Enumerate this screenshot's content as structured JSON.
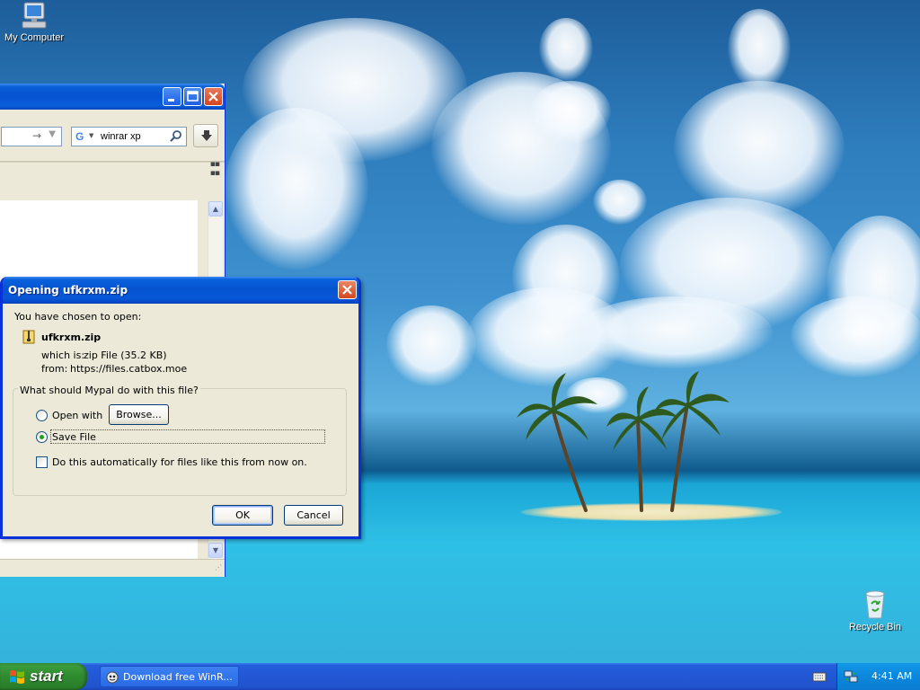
{
  "desktop": {
    "icons": [
      {
        "label": "My Computer"
      },
      {
        "label": "Recycle Bin"
      }
    ]
  },
  "browser": {
    "search_query": "winrar xp",
    "search_engine_icon": "google-icon"
  },
  "dialog": {
    "title": "Opening ufkrxm.zip",
    "intro": "You have chosen to open:",
    "file_name": "ufkrxm.zip",
    "which_is_label": "which is:",
    "which_is_value": "zip File (35.2 KB)",
    "from_label": "from:",
    "from_value": "https://files.catbox.moe",
    "question": "What should Mypal do with this file?",
    "open_with_label": "Open with",
    "browse_label": "Browse...",
    "save_file_label": "Save File",
    "auto_label": "Do this automatically for files like this from now on.",
    "selected_option": "Save File",
    "auto_checked": false,
    "ok_label": "OK",
    "cancel_label": "Cancel"
  },
  "taskbar": {
    "start_label": "start",
    "task_label": "Download free WinR...",
    "clock": "4:41 AM"
  },
  "colors": {
    "title_blue": "#0553cf",
    "start_green": "#2f8a2f",
    "tray_blue": "#0b87dc",
    "dialog_bg": "#ece9d8"
  }
}
